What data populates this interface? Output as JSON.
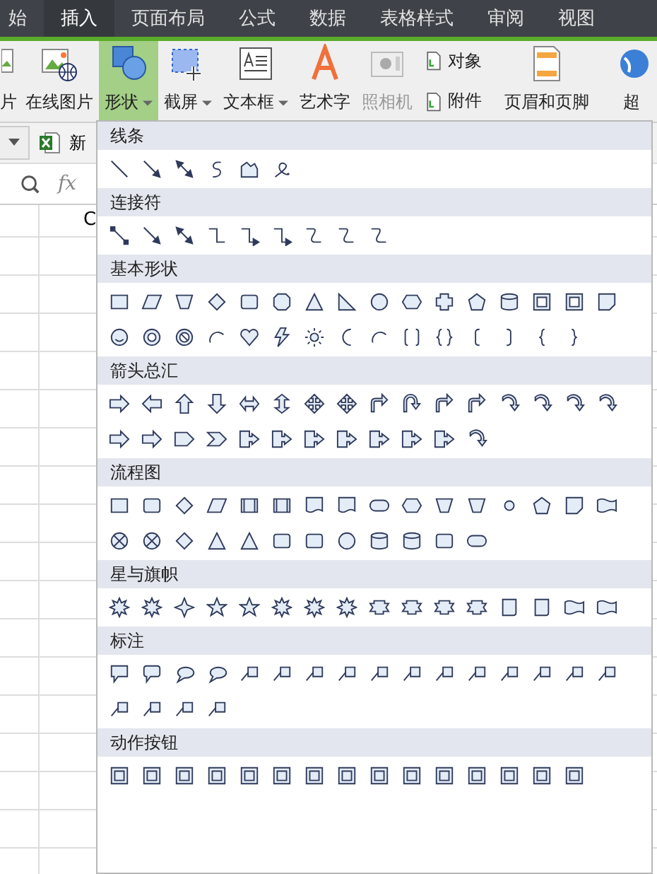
{
  "tabs": [
    {
      "label": "始",
      "selected": false
    },
    {
      "label": "插入",
      "selected": true
    },
    {
      "label": "页面布局",
      "selected": false
    },
    {
      "label": "公式",
      "selected": false
    },
    {
      "label": "数据",
      "selected": false
    },
    {
      "label": "表格样式",
      "selected": false
    },
    {
      "label": "审阅",
      "selected": false
    },
    {
      "label": "视图",
      "selected": false
    }
  ],
  "ribbon": [
    {
      "kind": "cut",
      "label": "片",
      "selected": false,
      "disabled": false,
      "dropdown": false
    },
    {
      "kind": "online-picture",
      "label": "在线图片",
      "selected": false,
      "disabled": false,
      "dropdown": false
    },
    {
      "kind": "shapes",
      "label": "形状",
      "selected": true,
      "disabled": false,
      "dropdown": true
    },
    {
      "kind": "screenshot",
      "label": "截屏",
      "selected": false,
      "disabled": false,
      "dropdown": true
    },
    {
      "kind": "textbox",
      "label": "文本框",
      "selected": false,
      "disabled": false,
      "dropdown": true
    },
    {
      "kind": "wordart",
      "label": "艺术字",
      "selected": false,
      "disabled": false,
      "dropdown": false
    },
    {
      "kind": "camera",
      "label": "照相机",
      "selected": false,
      "disabled": true,
      "dropdown": false
    },
    {
      "kind": "small-pair",
      "items": [
        "对象",
        "附件"
      ]
    },
    {
      "kind": "header-footer",
      "label": "页眉和页脚",
      "selected": false,
      "disabled": false,
      "dropdown": false
    },
    {
      "kind": "hyperlink",
      "label": "超",
      "selected": false,
      "disabled": false,
      "dropdown": false
    }
  ],
  "sheet": {
    "file_tab": "新",
    "fx": "fx",
    "column_header": "C"
  },
  "shapes_menu": [
    {
      "title": "线条",
      "shapes": [
        {
          "kind": "line"
        },
        {
          "kind": "arrow"
        },
        {
          "kind": "dblarrow"
        },
        {
          "kind": "curve"
        },
        {
          "kind": "freeform"
        },
        {
          "kind": "scribble"
        }
      ]
    },
    {
      "title": "连接符",
      "shapes": [
        {
          "kind": "connector"
        },
        {
          "kind": "arrow"
        },
        {
          "kind": "dblarrow"
        },
        {
          "kind": "elbow"
        },
        {
          "kind": "elbow-arrow"
        },
        {
          "kind": "elbow-arrow"
        },
        {
          "kind": "curvy"
        },
        {
          "kind": "curvy"
        },
        {
          "kind": "curvy"
        }
      ]
    },
    {
      "title": "基本形状",
      "shapes": [
        {
          "kind": "rect"
        },
        {
          "kind": "parallelogram"
        },
        {
          "kind": "trapezoid"
        },
        {
          "kind": "diamond"
        },
        {
          "kind": "rounded"
        },
        {
          "kind": "octagon"
        },
        {
          "kind": "triangle"
        },
        {
          "kind": "rtriangle"
        },
        {
          "kind": "circle"
        },
        {
          "kind": "hexagon"
        },
        {
          "kind": "cross"
        },
        {
          "kind": "pentagon"
        },
        {
          "kind": "can"
        },
        {
          "kind": "frame"
        },
        {
          "kind": "frame"
        },
        {
          "kind": "folded"
        },
        {
          "kind": "smiley"
        },
        {
          "kind": "donut"
        },
        {
          "kind": "nosymbol"
        },
        {
          "kind": "arc"
        },
        {
          "kind": "heart"
        },
        {
          "kind": "lightning"
        },
        {
          "kind": "sun"
        },
        {
          "kind": "moon"
        },
        {
          "kind": "arc"
        },
        {
          "kind": "brackets"
        },
        {
          "kind": "braces"
        },
        {
          "kind": "bracket-left"
        },
        {
          "kind": "bracket-right"
        },
        {
          "kind": "brace-left"
        },
        {
          "kind": "brace-right"
        }
      ]
    },
    {
      "title": "箭头总汇",
      "shapes": [
        {
          "kind": "arrow-right"
        },
        {
          "kind": "arrow-left"
        },
        {
          "kind": "arrow-up"
        },
        {
          "kind": "arrow-down"
        },
        {
          "kind": "arrow-lr"
        },
        {
          "kind": "arrow-ud"
        },
        {
          "kind": "arrow-quad"
        },
        {
          "kind": "arrow-quad"
        },
        {
          "kind": "bent-arrow"
        },
        {
          "kind": "uturn"
        },
        {
          "kind": "bent-arrow"
        },
        {
          "kind": "bent-arrow"
        },
        {
          "kind": "curved-arrow"
        },
        {
          "kind": "curved-arrow"
        },
        {
          "kind": "curved-arrow"
        },
        {
          "kind": "curved-arrow"
        },
        {
          "kind": "arrow-right"
        },
        {
          "kind": "arrow-right"
        },
        {
          "kind": "pentagon-arrow"
        },
        {
          "kind": "chevron"
        },
        {
          "kind": "callout-arrow"
        },
        {
          "kind": "callout-arrow"
        },
        {
          "kind": "callout-arrow"
        },
        {
          "kind": "callout-arrow"
        },
        {
          "kind": "callout-arrow"
        },
        {
          "kind": "callout-arrow"
        },
        {
          "kind": "callout-arrow"
        },
        {
          "kind": "curved-arrow"
        }
      ]
    },
    {
      "title": "流程图",
      "shapes": [
        {
          "kind": "rect"
        },
        {
          "kind": "rounded"
        },
        {
          "kind": "diamond"
        },
        {
          "kind": "parallelogram"
        },
        {
          "kind": "predefined"
        },
        {
          "kind": "predefined"
        },
        {
          "kind": "flow-doc"
        },
        {
          "kind": "flow-doc"
        },
        {
          "kind": "terminator"
        },
        {
          "kind": "hexagon"
        },
        {
          "kind": "trapezoid"
        },
        {
          "kind": "trapezoid"
        },
        {
          "kind": "circle-small"
        },
        {
          "kind": "pentagon"
        },
        {
          "kind": "folded"
        },
        {
          "kind": "wave"
        },
        {
          "kind": "flow-x"
        },
        {
          "kind": "flow-x"
        },
        {
          "kind": "diamond"
        },
        {
          "kind": "triangle"
        },
        {
          "kind": "triangle"
        },
        {
          "kind": "rounded"
        },
        {
          "kind": "rounded"
        },
        {
          "kind": "circle"
        },
        {
          "kind": "can"
        },
        {
          "kind": "can"
        },
        {
          "kind": "rounded"
        },
        {
          "kind": "terminator"
        }
      ]
    },
    {
      "title": "星与旗帜",
      "shapes": [
        {
          "kind": "burst"
        },
        {
          "kind": "burst"
        },
        {
          "kind": "star4"
        },
        {
          "kind": "star"
        },
        {
          "kind": "star"
        },
        {
          "kind": "burst"
        },
        {
          "kind": "burst"
        },
        {
          "kind": "burst"
        },
        {
          "kind": "ribbon"
        },
        {
          "kind": "ribbon"
        },
        {
          "kind": "ribbon"
        },
        {
          "kind": "ribbon"
        },
        {
          "kind": "scroll"
        },
        {
          "kind": "scroll"
        },
        {
          "kind": "wave"
        },
        {
          "kind": "wave"
        }
      ]
    },
    {
      "title": "标注",
      "shapes": [
        {
          "kind": "callout-rect"
        },
        {
          "kind": "callout-round"
        },
        {
          "kind": "callout-oval"
        },
        {
          "kind": "callout-oval"
        },
        {
          "kind": "callout-line"
        },
        {
          "kind": "callout-line"
        },
        {
          "kind": "callout-line"
        },
        {
          "kind": "callout-line"
        },
        {
          "kind": "callout-line"
        },
        {
          "kind": "callout-line"
        },
        {
          "kind": "callout-line"
        },
        {
          "kind": "callout-line"
        },
        {
          "kind": "callout-line"
        },
        {
          "kind": "callout-line"
        },
        {
          "kind": "callout-line"
        },
        {
          "kind": "callout-line"
        },
        {
          "kind": "callout-line"
        },
        {
          "kind": "callout-line"
        },
        {
          "kind": "callout-line"
        },
        {
          "kind": "callout-line"
        }
      ]
    },
    {
      "title": "动作按钮",
      "shapes": [
        {
          "kind": "action"
        },
        {
          "kind": "action"
        },
        {
          "kind": "action"
        },
        {
          "kind": "action"
        },
        {
          "kind": "action"
        },
        {
          "kind": "action"
        },
        {
          "kind": "action"
        },
        {
          "kind": "action"
        },
        {
          "kind": "action"
        },
        {
          "kind": "action"
        },
        {
          "kind": "action"
        },
        {
          "kind": "action"
        },
        {
          "kind": "action"
        },
        {
          "kind": "action"
        },
        {
          "kind": "action"
        }
      ]
    }
  ]
}
